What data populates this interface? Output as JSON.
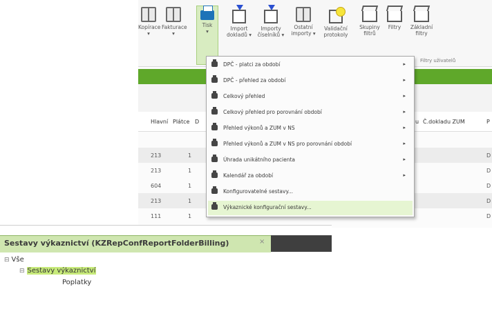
{
  "ribbon": {
    "buttons": [
      {
        "label": "Kopírace",
        "sub": "▾",
        "icon": "book-icon"
      },
      {
        "label": "Fakturace",
        "sub": "▾",
        "icon": "book-icon"
      },
      {
        "label": "Tisk",
        "sub": "▾",
        "icon": "printer-icon"
      },
      {
        "label": "Import",
        "sub": "dokladů ▾",
        "icon": "import-icon"
      },
      {
        "label": "Importy",
        "sub": "číselníků ▾",
        "icon": "import-icon"
      },
      {
        "label": "Ostatní",
        "sub": "importy ▾",
        "icon": "book-icon"
      },
      {
        "label": "Validační",
        "sub": "protokoly",
        "icon": "validation-icon"
      },
      {
        "label": "Skupiny",
        "sub": "filtrů",
        "icon": "tray-icon"
      },
      {
        "label": "Filtry",
        "sub": "",
        "icon": "tray-icon"
      },
      {
        "label": "Základní",
        "sub": "filtry",
        "icon": "tray-icon"
      }
    ],
    "hint": "Filtry uživatelů"
  },
  "grid": {
    "headers": [
      "Hlavní",
      "Plátce",
      "D",
      "u",
      "Č.dokladu ZUM",
      "P"
    ],
    "rows": [
      {
        "c1": "213",
        "c2": "1",
        "cz": "D"
      },
      {
        "c1": "213",
        "c2": "1",
        "cz": "D"
      },
      {
        "c1": "604",
        "c2": "1",
        "cz": "D"
      },
      {
        "c1": "213",
        "c2": "1",
        "cz": "D"
      },
      {
        "c1": "111",
        "c2": "1",
        "cz": "D"
      }
    ]
  },
  "menu": {
    "items": [
      {
        "label": "DPČ - platci za období",
        "submenu": true
      },
      {
        "label": "DPČ - přehled za období",
        "submenu": true
      },
      {
        "label": "Celkový přehled",
        "submenu": true
      },
      {
        "label": "Celkový přehled pro porovnání období",
        "submenu": true
      },
      {
        "label": "Přehled výkonů a ZUM v NS",
        "submenu": true
      },
      {
        "label": "Přehled výkonů a ZUM v NS pro porovnání období",
        "submenu": true
      },
      {
        "label": "Úhrada unikátního pacienta",
        "submenu": true
      },
      {
        "label": "Kalendář za období",
        "submenu": true
      },
      {
        "label": "Konfigurovatelné sestavy...",
        "submenu": false
      },
      {
        "label": "Výkaznické konfigurační sestavy...",
        "submenu": false
      }
    ],
    "highlighted_index": 9
  },
  "panel": {
    "tab_title": "Sestavy výkaznictví (KZRepConfReportFolderBilling)",
    "close_glyph": "×",
    "tree": {
      "root": "Vše",
      "root_expander": "⊟",
      "child": "Sestavy výkaznictví",
      "child_expander": "⊟",
      "leaf": "Poplatky"
    }
  },
  "colors": {
    "accent_green": "#5fa82a",
    "highlight_green": "#c7ea7a",
    "tab_green": "#cfe6b0",
    "menu_hover": "#e6f5d2"
  }
}
